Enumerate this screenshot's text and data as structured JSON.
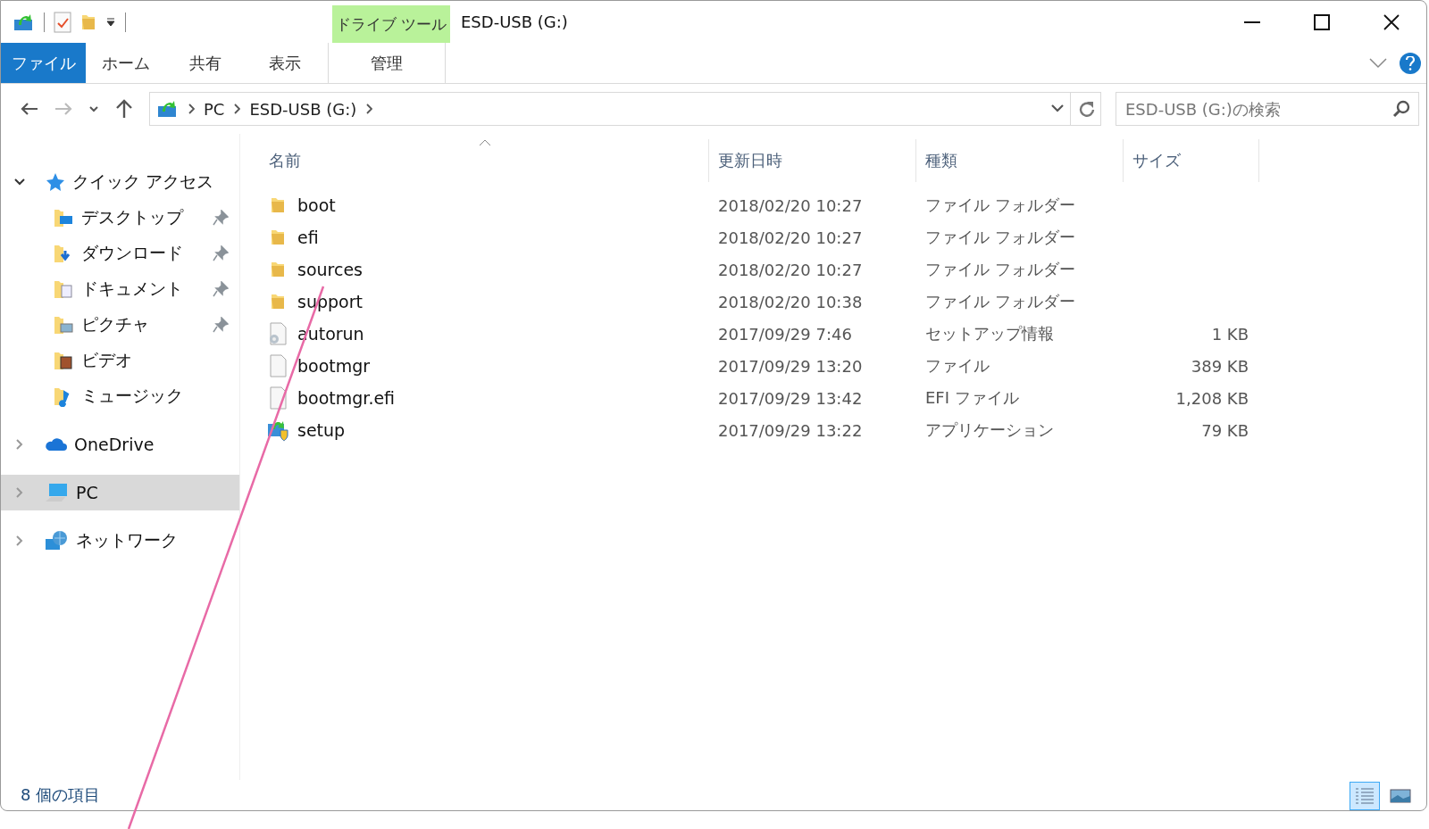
{
  "window": {
    "title": "ESD-USB (G:)",
    "context_group": "ドライブ ツール"
  },
  "ribbon_tabs": [
    {
      "label": "ファイル",
      "kind": "file",
      "selected": false
    },
    {
      "label": "ホーム",
      "kind": "tab",
      "selected": false
    },
    {
      "label": "共有",
      "kind": "tab",
      "selected": false
    },
    {
      "label": "表示",
      "kind": "tab",
      "selected": false
    },
    {
      "label": "管理",
      "kind": "context",
      "selected": false
    }
  ],
  "address": {
    "crumbs": [
      "PC",
      "ESD-USB (G:)"
    ]
  },
  "search": {
    "placeholder": "ESD-USB (G:)の検索"
  },
  "nav": [
    {
      "label": "クイック アクセス",
      "expanded": true,
      "selected": false,
      "children": [
        {
          "label": "デスクトップ",
          "pinned": true
        },
        {
          "label": "ダウンロード",
          "pinned": true
        },
        {
          "label": "ドキュメント",
          "pinned": true
        },
        {
          "label": "ピクチャ",
          "pinned": true
        },
        {
          "label": "ビデオ",
          "pinned": false
        },
        {
          "label": "ミュージック",
          "pinned": false
        }
      ]
    },
    {
      "label": "OneDrive",
      "expanded": false,
      "selected": false
    },
    {
      "label": "PC",
      "expanded": false,
      "selected": true
    },
    {
      "label": "ネットワーク",
      "expanded": false,
      "selected": false
    }
  ],
  "columns": [
    {
      "label": "名前",
      "sorted": true
    },
    {
      "label": "更新日時",
      "sorted": false
    },
    {
      "label": "種類",
      "sorted": false
    },
    {
      "label": "サイズ",
      "sorted": false
    }
  ],
  "files": [
    {
      "name": "boot",
      "kind": "folder",
      "date": "2018/02/20 10:27",
      "type": "ファイル フォルダー"
    },
    {
      "name": "efi",
      "kind": "folder",
      "date": "2018/02/20 10:27",
      "type": "ファイル フォルダー"
    },
    {
      "name": "sources",
      "kind": "folder",
      "date": "2018/02/20 10:27",
      "type": "ファイル フォルダー"
    },
    {
      "name": "support",
      "kind": "folder",
      "date": "2018/02/20 10:38",
      "type": "ファイル フォルダー"
    },
    {
      "name": "autorun",
      "kind": "settings",
      "date": "2017/09/29 7:46",
      "type": "セットアップ情報",
      "size": "1 KB"
    },
    {
      "name": "bootmgr",
      "kind": "file",
      "date": "2017/09/29 13:20",
      "type": "ファイル",
      "size": "389 KB"
    },
    {
      "name": "bootmgr.efi",
      "kind": "file",
      "date": "2017/09/29 13:42",
      "type": "EFI ファイル",
      "size": "1,208 KB"
    },
    {
      "name": "setup",
      "kind": "app",
      "date": "2017/09/29 13:22",
      "type": "アプリケーション",
      "size": "79 KB"
    }
  ],
  "status": {
    "count": "8 個の項目",
    "views": [
      {
        "kind": "details",
        "selected": true
      },
      {
        "kind": "large",
        "selected": false
      }
    ]
  }
}
